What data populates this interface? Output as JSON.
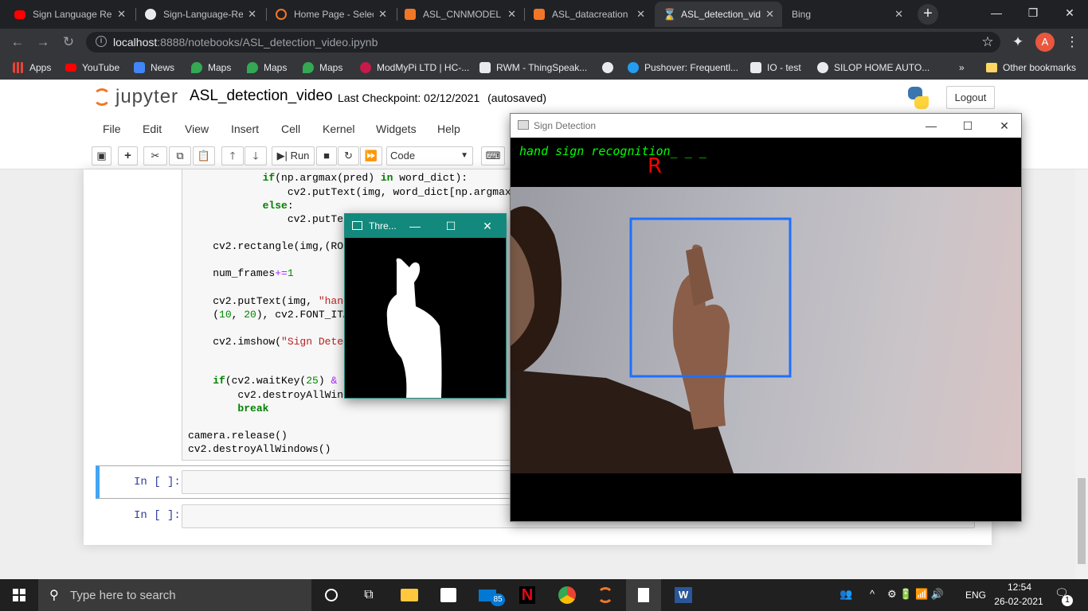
{
  "browser": {
    "tabs": [
      {
        "title": "Sign Language Re",
        "icon": "youtube-icon"
      },
      {
        "title": "Sign-Language-Re",
        "icon": "github-icon"
      },
      {
        "title": "Home Page - Selec",
        "icon": "jupyter-icon"
      },
      {
        "title": "ASL_CNNMODEL -",
        "icon": "notebook-icon"
      },
      {
        "title": "ASL_datacreation",
        "icon": "notebook-icon"
      },
      {
        "title": "ASL_detection_vid",
        "icon": "hourglass-icon"
      },
      {
        "title": "Bing",
        "icon": ""
      }
    ],
    "url_host": "localhost",
    "url_path": ":8888/notebooks/ASL_detection_video.ipynb",
    "profile_letter": "A",
    "bookmarks": [
      "Apps",
      "YouTube",
      "News",
      "Maps",
      "Maps",
      "Maps",
      "ModMyPi LTD | HC-...",
      "RWM - ThingSpeak...",
      "Pushover: Frequentl...",
      "IO - test",
      "SILOP HOME AUTO...",
      "»",
      "Other bookmarks"
    ]
  },
  "jupyter": {
    "logo_text": "jupyter",
    "notebook_name": "ASL_detection_video",
    "checkpoint": "Last Checkpoint: 02/12/2021",
    "autosave": "(autosaved)",
    "logout": "Logout",
    "menu": [
      "File",
      "Edit",
      "View",
      "Insert",
      "Cell",
      "Kernel",
      "Widgets",
      "Help"
    ],
    "toolbar": {
      "run": "Run",
      "cell_type": "Code"
    },
    "code_lines": [
      "            if(np.argmax(pred) in word_dict):",
      "                cv2.putText(img, word_dict[np.argmax(",
      "            else:",
      "                cv2.putTex",
      "",
      "    cv2.rectangle(img,(ROI",
      "",
      "    num_frames+=1",
      "",
      "    cv2.putText(img, \"hand",
      "    (10, 20), cv2.FONT_ITA",
      "",
      "    cv2.imshow(\"Sign Detec",
      "",
      "",
      "    if(cv2.waitKey(25) & 0",
      "        cv2.destroyAllWindo",
      "        break",
      "",
      "camera.release()",
      "cv2.destroyAllWindows()"
    ],
    "prompt": "In [ ]:"
  },
  "sign_window": {
    "title": "Sign Detection",
    "overlay_text": "hand sign recognition_ _ _",
    "predicted_letter": "R"
  },
  "thresh_window": {
    "title": "Thre..."
  },
  "taskbar": {
    "search_placeholder": "Type here to search",
    "mail_badge": "85",
    "language": "ENG",
    "time": "12:54",
    "date": "26-02-2021",
    "notification_count": "1"
  },
  "colors": {
    "accent": "#1a73e8",
    "jupyter_orange": "#f37626",
    "roi_box": "#1e6fff",
    "overlay_text": "#00ff00",
    "letter": "#ff0000"
  }
}
